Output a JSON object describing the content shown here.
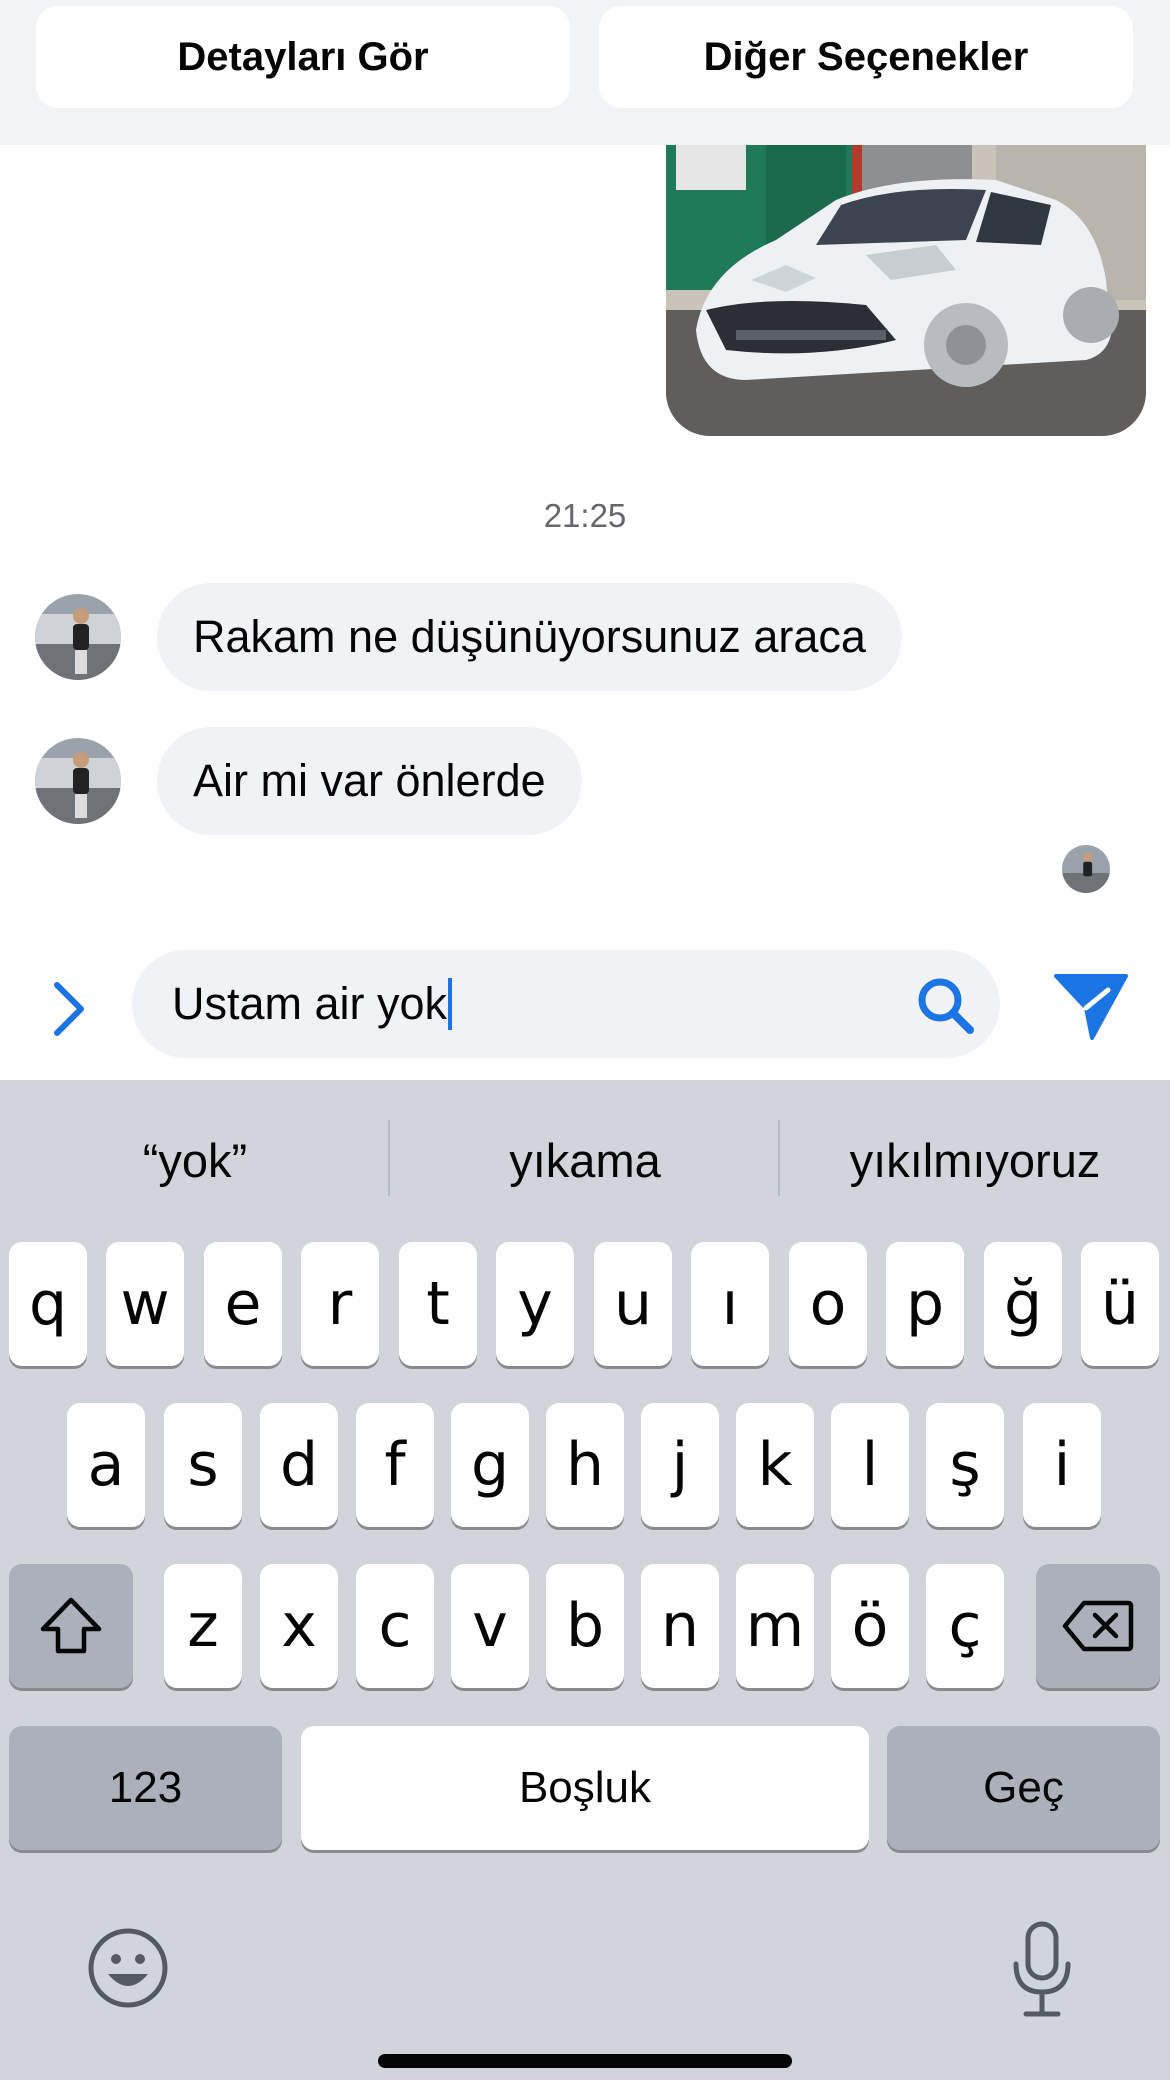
{
  "top_bar": {
    "details_label": "Detayları Gör",
    "options_label": "Diğer Seçenekler"
  },
  "conversation": {
    "timestamp": "21:25",
    "messages": [
      {
        "text": "Rakam ne düşünüyorsunuz araca",
        "sender": "other"
      },
      {
        "text": "Air mi var önlerde",
        "sender": "other"
      }
    ]
  },
  "composer": {
    "input_value": "Ustam air yok",
    "accent_color": "#1b74e4"
  },
  "keyboard": {
    "predictions": [
      "“yok”",
      "yıkama",
      "yıkılmıyoruz"
    ],
    "row1": [
      "q",
      "w",
      "e",
      "r",
      "t",
      "y",
      "u",
      "ı",
      "o",
      "p",
      "ğ",
      "ü"
    ],
    "row2": [
      "a",
      "s",
      "d",
      "f",
      "g",
      "h",
      "j",
      "k",
      "l",
      "ş",
      "i"
    ],
    "row3": [
      "z",
      "x",
      "c",
      "v",
      "b",
      "n",
      "m",
      "ö",
      "ç"
    ],
    "numbers_label": "123",
    "space_label": "Boşluk",
    "return_label": "Geç"
  },
  "icons": {
    "expand": "chevron-right-icon",
    "search": "search-icon",
    "send": "send-icon",
    "shift": "shift-icon",
    "backspace": "backspace-icon",
    "emoji": "emoji-icon",
    "mic": "microphone-icon"
  }
}
